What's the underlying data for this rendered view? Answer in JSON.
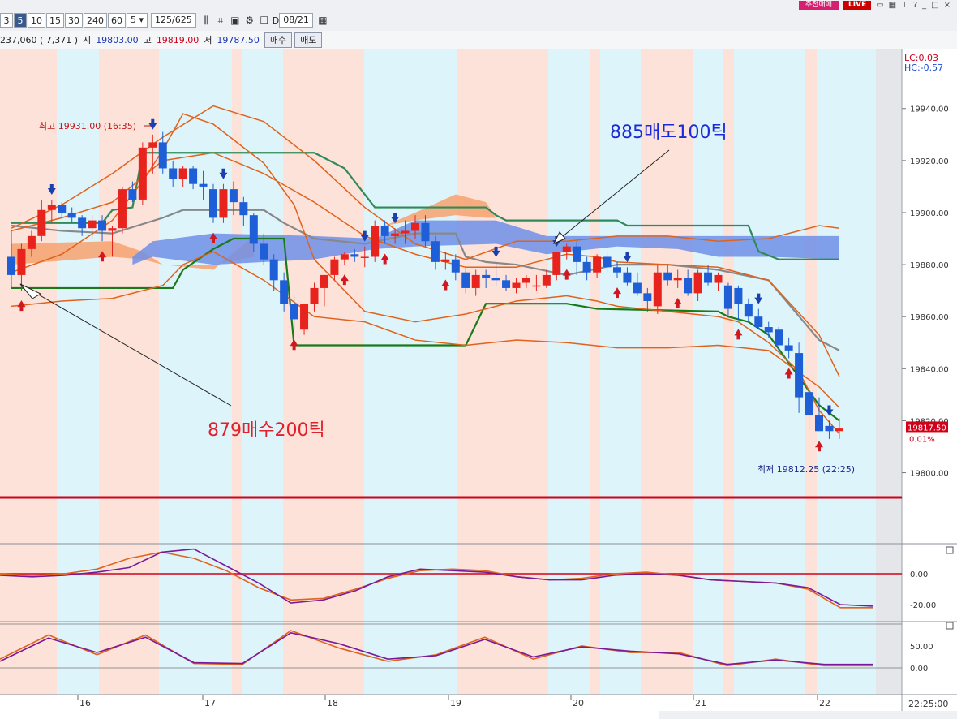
{
  "toolbar": {
    "periods": [
      "3",
      "5",
      "10",
      "15",
      "30",
      "240",
      "60"
    ],
    "active_period": "5",
    "period_select": "5",
    "count": "125",
    "total": "/625",
    "date_checkbox_label": "D",
    "date": "08/21",
    "right_badge": "추천매매",
    "live_badge": "LIVE"
  },
  "quote": {
    "volume": "237,060 ( 7,371 )",
    "open_label": "시",
    "open": "19803.00",
    "high_label": "고",
    "high": "19819.00",
    "low_label": "저",
    "low": "19787.50",
    "buy_button": "매수",
    "sell_button": "매도"
  },
  "chart_data": {
    "type": "candlestick",
    "y_ticks": [
      "19940.00",
      "19920.00",
      "19900.00",
      "19880.00",
      "19860.00",
      "19840.00",
      "19820.00",
      "19800.00"
    ],
    "ylim": [
      19793,
      19963
    ],
    "x_ticks": [
      "16",
      "17",
      "18",
      "19",
      "20",
      "21",
      "22"
    ],
    "time_label": "22:25:00",
    "lc_label": "LC:0.03",
    "hc_label": "HC:-0.57",
    "current_price": "19817.50",
    "current_change": "0.01%",
    "high_annotation": "최고 19931.00 (16:35)",
    "low_annotation": "최저 19812.25 (22:25)",
    "sell_annotation": "885매도100틱",
    "buy_annotation": "879매수200틱",
    "osc1_ticks": [
      "0.00",
      "-20.00"
    ],
    "osc2_ticks": [
      "50.00",
      "0.00"
    ],
    "colors": {
      "up": "#e8231d",
      "down": "#1e5ed6",
      "bg_red": "#fde2d9",
      "bg_blue": "#def4fb",
      "cloud_orange": "#f6a676",
      "cloud_blue": "#6f8fe8",
      "support_red": "#d0021b"
    },
    "candles": [
      [
        19883,
        19893,
        19871,
        19876
      ],
      [
        19876,
        19888,
        19870,
        19886
      ],
      [
        19886,
        19893,
        19883,
        19891
      ],
      [
        19891,
        19905,
        19889,
        19901
      ],
      [
        19901,
        19905,
        19896,
        19903
      ],
      [
        19903,
        19904,
        19898,
        19900
      ],
      [
        19900,
        19902,
        19896,
        19898
      ],
      [
        19898,
        19899,
        19891,
        19894
      ],
      [
        19894,
        19899,
        19890,
        19897
      ],
      [
        19897,
        19899,
        19889,
        19893
      ],
      [
        19893,
        19895,
        19883,
        19894
      ],
      [
        19894,
        19910,
        19892,
        19909
      ],
      [
        19909,
        19912,
        19904,
        19905
      ],
      [
        19905,
        19927,
        19903,
        19925
      ],
      [
        19925,
        19930,
        19915,
        19927
      ],
      [
        19927,
        19931,
        19915,
        19917
      ],
      [
        19917,
        19920,
        19910,
        19913
      ],
      [
        19913,
        19918,
        19910,
        19917
      ],
      [
        19917,
        19918,
        19909,
        19911
      ],
      [
        19911,
        19916,
        19905,
        19910
      ],
      [
        19909,
        19911,
        19896,
        19898
      ],
      [
        19898,
        19911,
        19896,
        19909
      ],
      [
        19909,
        19912,
        19899,
        19904
      ],
      [
        19904,
        19906,
        19895,
        19899
      ],
      [
        19899,
        19900,
        19885,
        19888
      ],
      [
        19888,
        19892,
        19880,
        19882
      ],
      [
        19882,
        19884,
        19870,
        19874
      ],
      [
        19874,
        19877,
        19862,
        19865
      ],
      [
        19865,
        19868,
        19855,
        19859
      ],
      [
        19855,
        19865,
        19853,
        19865
      ],
      [
        19865,
        19873,
        19862,
        19871
      ],
      [
        19871,
        19876,
        19864,
        19876
      ],
      [
        19876,
        19883,
        19874,
        19882
      ],
      [
        19882,
        19885,
        19880,
        19884
      ],
      [
        19884,
        19886,
        19881,
        19883
      ],
      [
        19883,
        19887,
        19879,
        19883
      ],
      [
        19883,
        19897,
        19881,
        19895
      ],
      [
        19895,
        19897,
        19888,
        19891
      ],
      [
        19891,
        19894,
        19888,
        19892
      ],
      [
        19892,
        19897,
        19888,
        19893
      ],
      [
        19893,
        19899,
        19890,
        19896
      ],
      [
        19896,
        19899,
        19887,
        19889
      ],
      [
        19889,
        19891,
        19878,
        19881
      ],
      [
        19881,
        19885,
        19878,
        19882
      ],
      [
        19882,
        19884,
        19874,
        19877
      ],
      [
        19877,
        19879,
        19869,
        19871
      ],
      [
        19871,
        19878,
        19868,
        19876
      ],
      [
        19876,
        19878,
        19871,
        19875
      ],
      [
        19875,
        19881,
        19872,
        19874
      ],
      [
        19874,
        19876,
        19870,
        19871
      ],
      [
        19871,
        19875,
        19869,
        19873
      ],
      [
        19873,
        19876,
        19871,
        19875
      ],
      [
        19872,
        19876,
        19870,
        19872
      ],
      [
        19872,
        19878,
        19871,
        19876
      ],
      [
        19876,
        19885,
        19874,
        19885
      ],
      [
        19885,
        19888,
        19882,
        19887
      ],
      [
        19887,
        19889,
        19876,
        19881
      ],
      [
        19881,
        19883,
        19874,
        19877
      ],
      [
        19877,
        19884,
        19875,
        19883
      ],
      [
        19883,
        19885,
        19877,
        19879
      ],
      [
        19879,
        19881,
        19875,
        19877
      ],
      [
        19877,
        19879,
        19872,
        19873
      ],
      [
        19873,
        19877,
        19868,
        19869
      ],
      [
        19869,
        19871,
        19862,
        19866
      ],
      [
        19864,
        19880,
        19861,
        19877
      ],
      [
        19877,
        19880,
        19872,
        19874
      ],
      [
        19874,
        19878,
        19871,
        19875
      ],
      [
        19875,
        19878,
        19868,
        19869
      ],
      [
        19869,
        19878,
        19866,
        19877
      ],
      [
        19877,
        19880,
        19872,
        19873
      ],
      [
        19873,
        19877,
        19870,
        19876
      ],
      [
        19872,
        19873,
        19860,
        19863
      ],
      [
        19871,
        19872,
        19859,
        19865
      ],
      [
        19865,
        19867,
        19858,
        19860
      ],
      [
        19860,
        19863,
        19855,
        19856
      ],
      [
        19856,
        19858,
        19852,
        19854
      ],
      [
        19855,
        19856,
        19847,
        19849
      ],
      [
        19849,
        19852,
        19844,
        19847
      ],
      [
        19846,
        19850,
        19823,
        19829
      ],
      [
        19831,
        19834,
        19816,
        19822
      ],
      [
        19822,
        19829,
        19816,
        19816
      ],
      [
        19818,
        19820,
        19813,
        19816
      ],
      [
        19816,
        19821,
        19813,
        19817
      ]
    ],
    "series": [
      {
        "name": "",
        "color": "#888888",
        "x": [
          0,
          5,
          10,
          15,
          17,
          20,
          25,
          27,
          30,
          35,
          40,
          44,
          45,
          47,
          50,
          55,
          60,
          65,
          70,
          75,
          80,
          82
        ],
        "y": [
          19895,
          19893,
          19892,
          19898,
          19901,
          19901,
          19901,
          19896,
          19890,
          19888,
          19892,
          19892,
          19883,
          19881,
          19880,
          19876,
          19880,
          19880,
          19878,
          19874,
          19851,
          19847
        ]
      },
      {
        "name": "",
        "color": "#2f8a58",
        "x": [
          0,
          9,
          10,
          12,
          13,
          30,
          33,
          35,
          36,
          38,
          47,
          48,
          49,
          50,
          60,
          61,
          73,
          74,
          76,
          82
        ],
        "y": [
          19896,
          19896,
          19901,
          19902,
          19923,
          19923,
          19917,
          19907,
          19902,
          19902,
          19902,
          19899,
          19897,
          19897,
          19897,
          19895,
          19895,
          19885,
          19882,
          19882
        ]
      },
      {
        "name": "",
        "color": "#1a7a1a",
        "x": [
          0,
          16,
          17,
          20,
          22,
          27,
          28,
          45,
          47,
          55,
          58,
          70,
          71,
          73,
          75,
          80,
          82
        ],
        "y": [
          19871,
          19871,
          19878,
          19886,
          19890,
          19890,
          19849,
          19849,
          19865,
          19865,
          19863,
          19862,
          19860,
          19858,
          19853,
          19826,
          19820
        ]
      },
      {
        "name": "",
        "color": "#e0621b",
        "x": [
          0,
          5,
          10,
          13,
          15,
          17,
          20,
          25,
          28,
          30,
          35,
          40,
          45,
          50,
          55,
          58,
          60,
          65,
          70,
          72,
          75,
          78,
          80,
          82
        ],
        "y": [
          19877,
          19884,
          19897,
          19912,
          19924,
          19938,
          19934,
          19919,
          19903,
          19882,
          19862,
          19858,
          19861,
          19866,
          19868,
          19866,
          19864,
          19862,
          19860,
          19858,
          19850,
          19839,
          19824,
          19815
        ]
      },
      {
        "name": "",
        "color": "#e0621b",
        "x": [
          0,
          5,
          10,
          15,
          20,
          25,
          30,
          35,
          40,
          45,
          50,
          55,
          58,
          60,
          65,
          70,
          75,
          80,
          82
        ],
        "y": [
          19893,
          19898,
          19904,
          19920,
          19923,
          19915,
          19904,
          19891,
          19884,
          19879,
          19879,
          19884,
          19883,
          19881,
          19880,
          19879,
          19874,
          19853,
          19837
        ]
      },
      {
        "name": "",
        "color": "#e0621b",
        "x": [
          0,
          5,
          10,
          15,
          17,
          20,
          25,
          30,
          35,
          40,
          45,
          50,
          55,
          60,
          65,
          70,
          75,
          80,
          82
        ],
        "y": [
          19864,
          19866,
          19867,
          19872,
          19880,
          19885,
          19874,
          19860,
          19858,
          19851,
          19849,
          19851,
          19850,
          19848,
          19848,
          19849,
          19847,
          19833,
          19825
        ]
      },
      {
        "name": "",
        "color": "#e0621b",
        "x": [
          0,
          5,
          10,
          15,
          20,
          25,
          30,
          35,
          40,
          45,
          50,
          55,
          60,
          65,
          70,
          75,
          80,
          82
        ],
        "y": [
          19894,
          19903,
          19915,
          19929,
          19941,
          19935,
          19920,
          19902,
          19888,
          19882,
          19889,
          19889,
          19891,
          19891,
          19889,
          19890,
          19895,
          19894
        ]
      }
    ],
    "sell_arrows": [
      4,
      14,
      21,
      35,
      38,
      48,
      54,
      61,
      74,
      81
    ],
    "buy_arrows": [
      1,
      9,
      20,
      28,
      33,
      37,
      43,
      55,
      60,
      66,
      72,
      77,
      80
    ],
    "osc1": {
      "zero_index": 0,
      "series_a": [
        0,
        -1,
        0,
        3,
        10,
        14,
        10,
        2,
        -9,
        -17,
        -16,
        -10,
        -3,
        2,
        3,
        2,
        -2,
        -4,
        -3,
        0,
        1,
        -1,
        -4,
        -5,
        -6,
        -10,
        -22,
        -22
      ],
      "series_b": [
        -1,
        -2,
        -1,
        1,
        4,
        14,
        16,
        5,
        -6,
        -19,
        -17,
        -11,
        -2,
        3,
        2,
        1,
        -2,
        -4,
        -4,
        -1,
        0,
        -1,
        -4,
        -5,
        -6,
        -9,
        -20,
        -21
      ]
    },
    "osc2": {
      "series_a": [
        20,
        75,
        30,
        75,
        10,
        8,
        85,
        45,
        15,
        30,
        70,
        20,
        50,
        35,
        35,
        5,
        20,
        5,
        5
      ],
      "series_b": [
        15,
        68,
        35,
        70,
        12,
        10,
        80,
        55,
        20,
        28,
        65,
        25,
        48,
        38,
        32,
        8,
        18,
        8,
        8
      ]
    }
  }
}
